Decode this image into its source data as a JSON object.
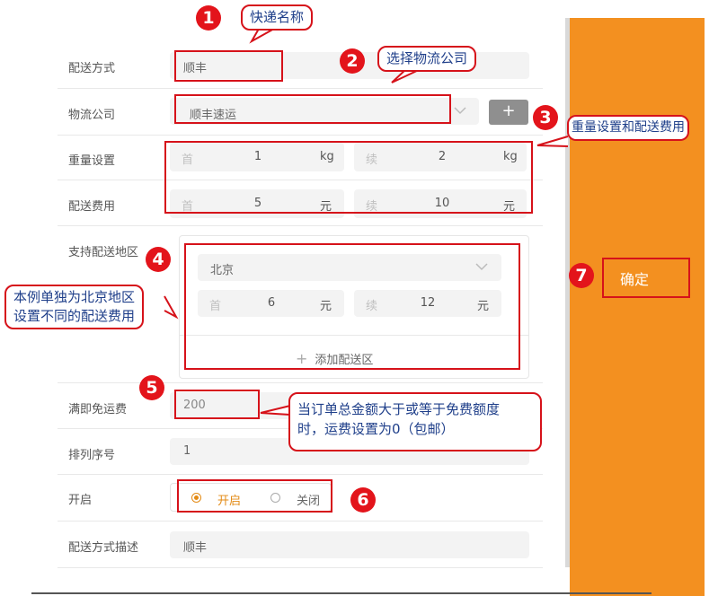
{
  "annotations": {
    "badges": [
      "1",
      "2",
      "3",
      "4",
      "5",
      "6",
      "7"
    ],
    "courier_name": "快递名称",
    "select_company": "选择物流公司",
    "weight_fee": "重量设置和配送费用",
    "beijing_note_1": "本例单独为北京地区",
    "beijing_note_2": "设置不同的配送费用",
    "free_note_1": "当订单总金额大于或等于免费额度",
    "free_note_2": "时，运费设置为0（包邮）"
  },
  "form": {
    "delivery_method": {
      "label": "配送方式",
      "value": "顺丰"
    },
    "logistics_company": {
      "label": "物流公司",
      "value": "顺丰速运",
      "add_button": "+"
    },
    "weight": {
      "label": "重量设置",
      "first_hint": "首",
      "first_value": "1",
      "first_unit": "kg",
      "cont_hint": "续",
      "cont_value": "2",
      "cont_unit": "kg"
    },
    "fee": {
      "label": "配送费用",
      "first_hint": "首",
      "first_value": "5",
      "first_unit": "元",
      "cont_hint": "续",
      "cont_value": "10",
      "cont_unit": "元"
    },
    "region": {
      "label": "支持配送地区",
      "region_name": "北京",
      "first_hint": "首",
      "first_value": "6",
      "first_unit": "元",
      "cont_hint": "续",
      "cont_value": "12",
      "cont_unit": "元",
      "add_region": "添加配送区"
    },
    "free_shipping": {
      "label": "满即免运费",
      "value": "200"
    },
    "sort_order": {
      "label": "排列序号",
      "value": "1"
    },
    "enabled": {
      "label": "开启",
      "on_label": "开启",
      "off_label": "关闭",
      "selected": "开启"
    },
    "description": {
      "label": "配送方式描述",
      "value": "顺丰"
    }
  },
  "sidebar": {
    "confirm_label": "确定",
    "color": "#f39020"
  },
  "colors": {
    "annotation_red": "#d6121a",
    "callout_text": "#1f3f8a",
    "radio_accent": "#e38a14"
  }
}
